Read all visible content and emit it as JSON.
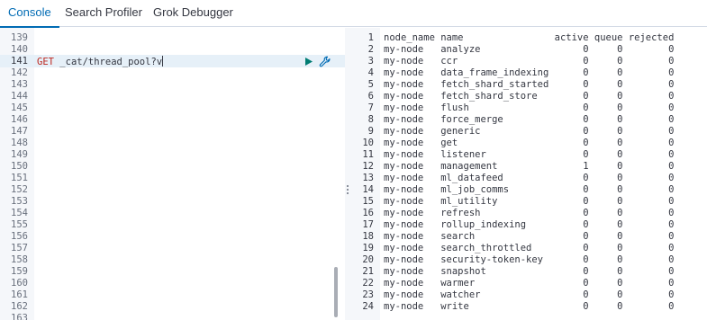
{
  "tabs": [
    {
      "label": "Console",
      "active": true
    },
    {
      "label": "Search Profiler",
      "active": false
    },
    {
      "label": "Grok Debugger",
      "active": false
    }
  ],
  "editor": {
    "line_numbers": [
      "139",
      "140",
      "141",
      "142",
      "143",
      "144",
      "145",
      "146",
      "147",
      "148",
      "149",
      "150",
      "151",
      "152",
      "153",
      "154",
      "155",
      "156",
      "157",
      "158",
      "159",
      "160",
      "161",
      "162",
      "163"
    ],
    "active_line": "141",
    "request": {
      "method": "GET",
      "path": "_cat/thread_pool?v"
    },
    "run_icon": "play-icon",
    "settings_icon": "wrench-icon",
    "accent_color": "#017d73"
  },
  "output": {
    "line_numbers": [
      "1",
      "2",
      "3",
      "4",
      "5",
      "6",
      "7",
      "8",
      "9",
      "10",
      "11",
      "12",
      "13",
      "14",
      "15",
      "16",
      "17",
      "18",
      "19",
      "20",
      "21",
      "22",
      "23",
      "24"
    ],
    "lines": [
      "node_name name                active queue rejected",
      "my-node   analyze                  0     0        0",
      "my-node   ccr                      0     0        0",
      "my-node   data_frame_indexing      0     0        0",
      "my-node   fetch_shard_started      0     0        0",
      "my-node   fetch_shard_store        0     0        0",
      "my-node   flush                    0     0        0",
      "my-node   force_merge              0     0        0",
      "my-node   generic                  0     0        0",
      "my-node   get                      0     0        0",
      "my-node   listener                 0     0        0",
      "my-node   management               1     0        0",
      "my-node   ml_datafeed              0     0        0",
      "my-node   ml_job_comms             0     0        0",
      "my-node   ml_utility               0     0        0",
      "my-node   refresh                  0     0        0",
      "my-node   rollup_indexing          0     0        0",
      "my-node   search                   0     0        0",
      "my-node   search_throttled         0     0        0",
      "my-node   security-token-key       0     0        0",
      "my-node   snapshot                 0     0        0",
      "my-node   warmer                   0     0        0",
      "my-node   watcher                  0     0        0",
      "my-node   write                    0     0        0"
    ]
  }
}
